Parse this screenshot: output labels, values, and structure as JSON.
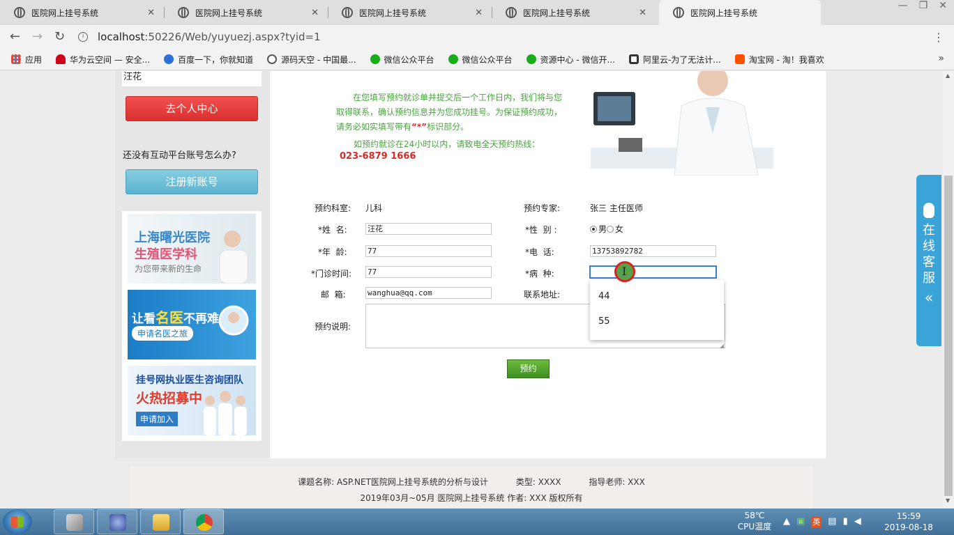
{
  "browser": {
    "tabs": [
      {
        "title": "医院网上挂号系统",
        "active": false
      },
      {
        "title": "医院网上挂号系统",
        "active": false
      },
      {
        "title": "医院网上挂号系统",
        "active": false
      },
      {
        "title": "医院网上挂号系统",
        "active": false
      },
      {
        "title": "医院网上挂号系统",
        "active": true
      }
    ],
    "url_host": "localhost",
    "url_rest": ":50226/Web/yuyuezj.aspx?tyid=1",
    "bookmarks": [
      {
        "label": "应用",
        "color": "#e24b3b"
      },
      {
        "label": "华为云空间 — 安全...",
        "color": "#d0021b"
      },
      {
        "label": "百度一下，你就知道",
        "color": "#2e6fd9"
      },
      {
        "label": "源码天空 - 中国最...",
        "color": "#555555"
      },
      {
        "label": "微信公众平台",
        "color": "#1aad19"
      },
      {
        "label": "微信公众平台",
        "color": "#1aad19"
      },
      {
        "label": "资源中心 - 微信开...",
        "color": "#1aad19"
      },
      {
        "label": "阿里云-为了无法计...",
        "color": "#333333"
      },
      {
        "label": "淘宝网 - 淘！我喜欢",
        "color": "#ff5000"
      }
    ]
  },
  "sidebar": {
    "username": "汪花",
    "personal_center_button": "去个人中心",
    "no_account_text": "还没有互动平台账号怎么办?",
    "register_button": "注册新账号",
    "ads": {
      "ad1_line1": "上海曙光医院",
      "ad1_line2": "生殖医学科",
      "ad1_line3": "为您带来新的生命",
      "ad2_line1_a": "让看",
      "ad2_line1_b": "名医",
      "ad2_line1_c": "不再难!",
      "ad2_pill": "申请名医之旅",
      "ad3_line1": "挂号网执业医生咨询团队",
      "ad3_line2": "火热招募中",
      "ad3_pill": "申请加入"
    }
  },
  "intro": {
    "paragraph_before": "在您填写预约就诊单并提交后一个工作日内，我们将与您取得联系，确认预约信息并为您成功挂号。为保证预约成功，请务必如实填写带有",
    "star_mark": "“*”",
    "paragraph_after": "标识部分。",
    "hotline_text": "如预约就诊在24小时以内，请致电全天预约热线：",
    "hotline": "023-6879 1666"
  },
  "form": {
    "department_label": "预约科室:",
    "department_value": "儿科",
    "expert_label": "预约专家:",
    "expert_value": "张三 主任医师",
    "name_label": "*姓  名:",
    "name_value": "汪花",
    "gender_label": "*性  别 :",
    "gender_male": "男",
    "gender_female": "女",
    "age_label": "*年  龄:",
    "age_value": "77",
    "phone_label": "*电  话:",
    "phone_value": "13753892782",
    "visit_time_label": "*门诊时间:",
    "visit_time_value": "77",
    "disease_label": "*病  种:",
    "disease_value": "",
    "email_label": "邮  箱:",
    "email_value": "wanghua@qq.com",
    "address_label": "联系地址:",
    "description_label": "预约说明:",
    "autocomplete": [
      "44",
      "55"
    ],
    "submit_button": "预约"
  },
  "footer": {
    "topic": "课题名称: ASP.NET医院网上挂号系统的分析与设计",
    "type": "类型: XXXX",
    "advisor": "指导老师: XXX",
    "copyright": "2019年03月~05月 医院网上挂号系统 作者: XXX 版权所有"
  },
  "float_service": {
    "label": "在线客服",
    "chevron": "«"
  },
  "taskbar": {
    "temp": "58℃",
    "temp_label": "CPU温度",
    "ime": "英",
    "time": "15:59",
    "date": "2019-08-18"
  }
}
